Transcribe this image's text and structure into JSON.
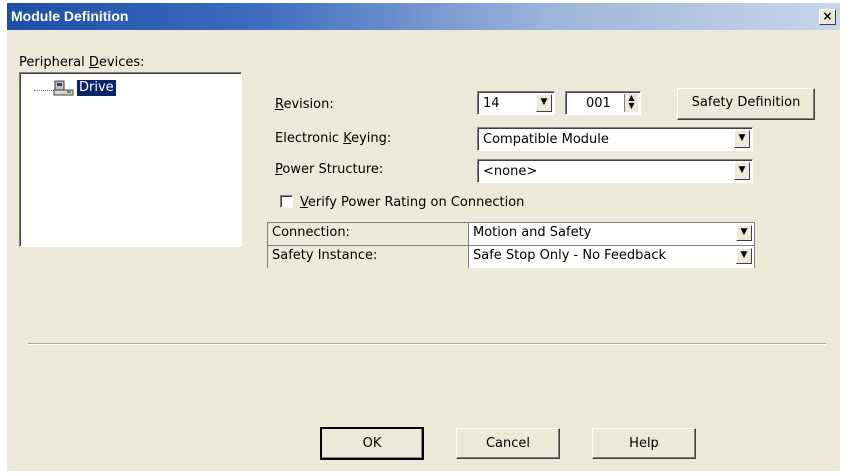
{
  "window": {
    "title": "Module Definition",
    "close_glyph": "×"
  },
  "peripheral": {
    "label_pre": "Peripheral ",
    "label_accel": "D",
    "label_post": "evices:",
    "tree_items": [
      {
        "label": "Drive",
        "icon": "drive-icon",
        "selected": true
      }
    ]
  },
  "revision": {
    "label_accel": "R",
    "label_post": "evision:",
    "major": "14",
    "minor": "001"
  },
  "safety_definition_button": "Safety Definition",
  "electronic_keying": {
    "label_pre": "Electronic ",
    "label_accel": "K",
    "label_post": "eying:",
    "value": "Compatible Module"
  },
  "power_structure": {
    "label_accel": "P",
    "label_post": "ower Structure:",
    "value": "<none>"
  },
  "verify_checkbox": {
    "label_accel": "V",
    "label_post": "erify Power Rating on Connection",
    "checked": false
  },
  "grid": {
    "rows": [
      {
        "label": "Connection:",
        "value": "Motion and Safety"
      },
      {
        "label": "Safety Instance:",
        "value": "Safe Stop Only - No Feedback"
      }
    ]
  },
  "buttons": {
    "ok": "OK",
    "cancel": "Cancel",
    "help": "Help"
  }
}
